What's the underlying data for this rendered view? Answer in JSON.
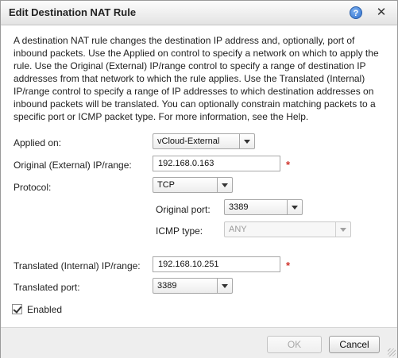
{
  "dialog": {
    "title": "Edit Destination NAT Rule",
    "help_icon_glyph": "?",
    "close_icon_glyph": "✕",
    "description": "A destination NAT rule changes the destination IP address and, optionally, port of inbound packets. Use the Applied on control to specify a network on which to apply the rule. Use the Original (External) IP/range control to specify a range of destination IP addresses from that network to which the rule applies. Use the Translated (Internal) IP/range control to specify a range of IP addresses to which destination addresses on inbound packets will be translated. You can optionally constrain matching packets to a specific port or ICMP packet type. For more information, see the Help."
  },
  "form": {
    "applied_on": {
      "label": "Applied on:",
      "value": "vCloud-External"
    },
    "original_ip": {
      "label": "Original (External) IP/range:",
      "value": "192.168.0.163",
      "required_marker": "*"
    },
    "protocol": {
      "label": "Protocol:",
      "value": "TCP"
    },
    "original_port": {
      "label": "Original port:",
      "value": "3389"
    },
    "icmp_type": {
      "label": "ICMP type:",
      "value": "ANY",
      "disabled": true
    },
    "translated_ip": {
      "label": "Translated (Internal) IP/range:",
      "value": "192.168.10.251",
      "required_marker": "*"
    },
    "translated_port": {
      "label": "Translated port:",
      "value": "3389"
    },
    "enabled": {
      "label": "Enabled",
      "checked": true
    }
  },
  "footer": {
    "ok_label": "OK",
    "cancel_label": "Cancel"
  },
  "colors": {
    "required": "#d0342c",
    "help_icon": "#2e6fce"
  },
  "icons": [
    "help-icon",
    "close-icon",
    "chevron-down-icon",
    "checkmark-icon",
    "resize-grip-icon"
  ]
}
